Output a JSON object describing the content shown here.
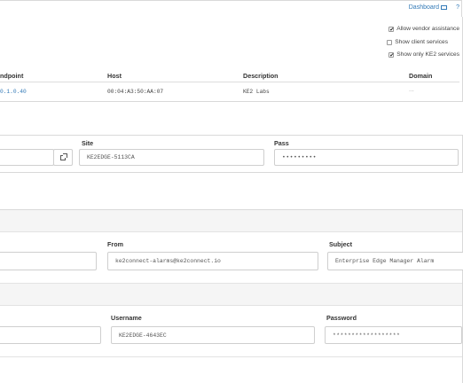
{
  "topbar": {
    "dashboard_label": "Dashboard",
    "help_label": "?"
  },
  "options": [
    {
      "label": "Allow vendor assistance",
      "checked": true
    },
    {
      "label": "Show client services",
      "checked": false
    },
    {
      "label": "Show only KE2 services",
      "checked": true
    }
  ],
  "services_table": {
    "headers": [
      "ndpoint",
      "Host",
      "Description",
      "Domain"
    ],
    "row": {
      "endpoint": "0.1.0.40",
      "host": "00:04:A3:50:AA:07",
      "description": "KE2 Labs",
      "domain": "..."
    }
  },
  "site_panel": {
    "site_label": "Site",
    "site_value": "KE2EDGE-5113CA",
    "pass_label": "Pass",
    "pass_value": "•••••••••",
    "external_link_icon": "external-link-icon"
  },
  "email_panel": {
    "from_label": "From",
    "from_value": "ke2connect-alarms@ke2connect.io",
    "subject_label": "Subject",
    "subject_value": "Enterprise Edge Manager Alarm"
  },
  "login_panel": {
    "username_label": "Username",
    "username_value": "KE2EDGE-4643EC",
    "password_label": "Password",
    "password_value": "******************"
  },
  "colors": {
    "link": "#337ab7",
    "border": "#d9d9d9",
    "header_bg": "#f5f5f5"
  }
}
